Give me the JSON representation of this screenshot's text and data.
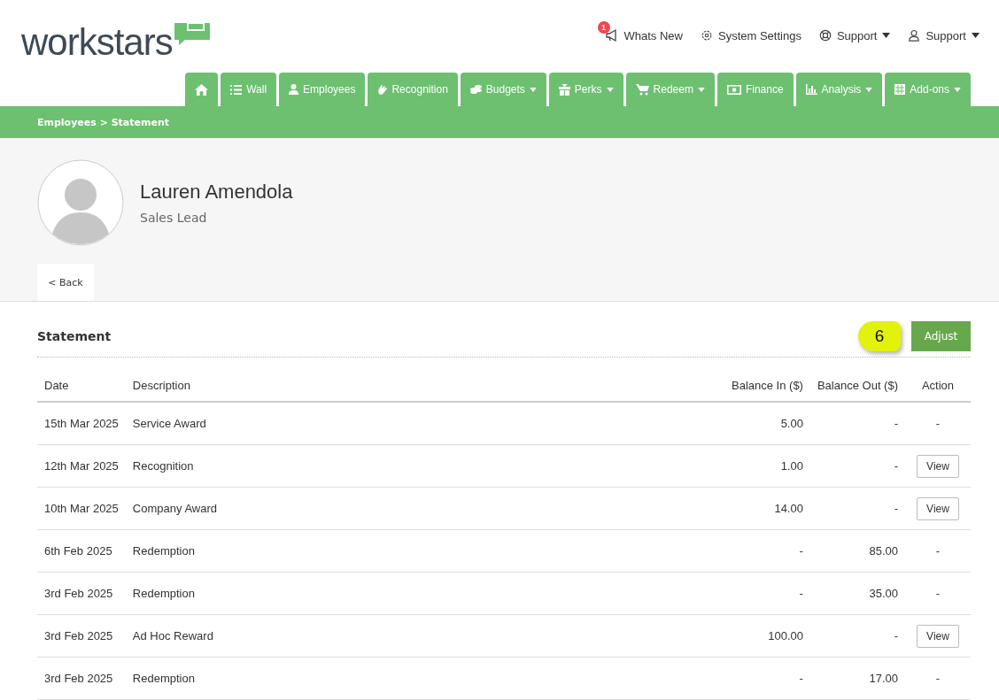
{
  "logo": {
    "text": "workstars"
  },
  "top_links": [
    {
      "label": "Whats New",
      "kind": "news",
      "badge": "1",
      "dropdown": false
    },
    {
      "label": "System Settings",
      "kind": "settings",
      "dropdown": false
    },
    {
      "label": "Support",
      "kind": "help",
      "dropdown": true
    },
    {
      "label": "Support",
      "kind": "user",
      "dropdown": true
    }
  ],
  "tabs": [
    {
      "kind": "home",
      "dropdown": false
    },
    {
      "label": "Wall",
      "kind": "list",
      "dropdown": false
    },
    {
      "label": "Employees",
      "kind": "person",
      "dropdown": false
    },
    {
      "label": "Recognition",
      "kind": "clap",
      "dropdown": false
    },
    {
      "label": "Budgets",
      "kind": "coins",
      "dropdown": true
    },
    {
      "label": "Perks",
      "kind": "gift",
      "dropdown": true
    },
    {
      "label": "Redeem",
      "kind": "cart",
      "dropdown": true
    },
    {
      "label": "Finance",
      "kind": "money",
      "dropdown": false
    },
    {
      "label": "Analysis",
      "kind": "chart",
      "dropdown": true
    },
    {
      "label": "Add-ons",
      "kind": "grid",
      "dropdown": true
    }
  ],
  "breadcrumb": "Employees > Statement",
  "profile": {
    "name": "Lauren Amendola",
    "role": "Sales Lead"
  },
  "back_button": "< Back",
  "statement": {
    "title": "Statement",
    "callout": "6",
    "adjust_button": "Adjust",
    "columns": [
      "Date",
      "Description",
      "Balance In ($)",
      "Balance Out ($)",
      "Action"
    ],
    "rows": [
      {
        "date": "15th Mar 2025",
        "description": "Service Award",
        "in": "5.00",
        "out": "-",
        "action": {
          "kind": "text",
          "text": "-"
        }
      },
      {
        "date": "12th Mar 2025",
        "description": "Recognition",
        "in": "1.00",
        "out": "-",
        "action": {
          "kind": "button",
          "text": "View"
        }
      },
      {
        "date": "10th Mar 2025",
        "description": "Company Award",
        "in": "14.00",
        "out": "-",
        "action": {
          "kind": "button",
          "text": "View"
        }
      },
      {
        "date": "6th Feb 2025",
        "description": "Redemption",
        "in": "-",
        "out": "85.00",
        "action": {
          "kind": "text",
          "text": "-"
        }
      },
      {
        "date": "3rd Feb 2025",
        "description": "Redemption",
        "in": "-",
        "out": "35.00",
        "action": {
          "kind": "text",
          "text": "-"
        }
      },
      {
        "date": "3rd Feb 2025",
        "description": "Ad Hoc Reward",
        "in": "100.00",
        "out": "-",
        "action": {
          "kind": "button",
          "text": "View"
        }
      },
      {
        "date": "3rd Feb 2025",
        "description": "Redemption",
        "in": "-",
        "out": "17.00",
        "action": {
          "kind": "text",
          "text": "-"
        }
      }
    ]
  }
}
